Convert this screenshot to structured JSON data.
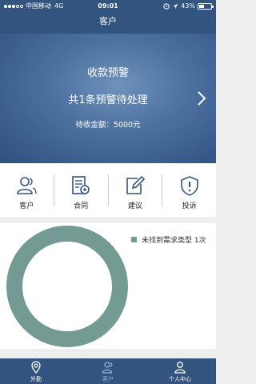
{
  "status_bar": {
    "carrier": "中国移动",
    "network": "4G",
    "time": "09:01",
    "battery": "43%",
    "battery_level": 0.43
  },
  "header": {
    "title": "客户"
  },
  "banner": {
    "title": "收款预警",
    "subtitle": "共1条预警待处理",
    "amount_text": "待收金额：5000元"
  },
  "categories": [
    {
      "label": "客户",
      "icon": "customer-icon"
    },
    {
      "label": "合同",
      "icon": "contract-icon"
    },
    {
      "label": "建议",
      "icon": "suggestion-icon"
    },
    {
      "label": "投诉",
      "icon": "complaint-icon"
    }
  ],
  "chart_data": {
    "type": "pie",
    "title": "",
    "slices": [
      {
        "label": "未找到需求类型 1次",
        "value": 1,
        "color": "#739b93"
      }
    ],
    "legend": "top-right"
  },
  "tabbar": {
    "items": [
      {
        "label": "外勤",
        "icon": "location-pin-icon",
        "active": false
      },
      {
        "label": "客户",
        "icon": "customers-icon",
        "active": true
      },
      {
        "label": "个人中心",
        "icon": "profile-icon",
        "active": false
      }
    ]
  },
  "colors": {
    "primary": "#33547f",
    "ring": "#739b93",
    "active_tab": "#8fb3d9"
  }
}
